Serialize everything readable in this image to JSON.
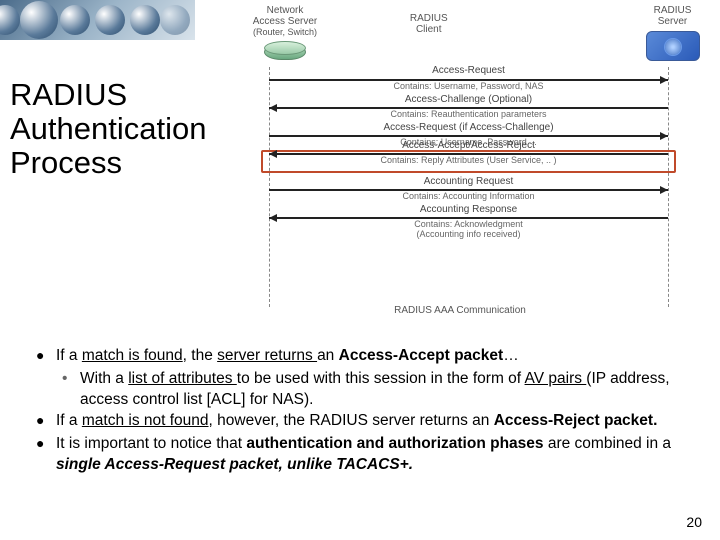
{
  "title": "RADIUS Authentication Process",
  "diagram": {
    "left": {
      "line1": "Network",
      "line2": "Access Server",
      "line3": "(Router, Switch)",
      "sub": "RADIUS\nClient"
    },
    "right": {
      "line1": "RADIUS",
      "line2": "Server"
    },
    "messages": [
      {
        "dir": "right",
        "label": "Access-Request",
        "sub": "Contains: Username, Password, NAS"
      },
      {
        "dir": "left",
        "label": "Access-Challenge (Optional)",
        "sub": "Contains: Reauthentication parameters"
      },
      {
        "dir": "right",
        "label": "Access-Request (if Access-Challenge)",
        "sub": "Contains: Username, Password, .."
      },
      {
        "dir": "left",
        "label": "Access-Accept/Access-Reject",
        "sub": "Contains: Reply Attributes (User Service, .. )",
        "hl": true
      },
      {
        "dir": "right",
        "label": "Accounting Request",
        "sub": "Contains: Accounting Information"
      },
      {
        "dir": "left",
        "label": "Accounting Response",
        "sub": "Contains: Acknowledgment\n(Accounting info received)"
      }
    ],
    "caption": "RADIUS AAA Communication"
  },
  "bullets": {
    "b1_pre": "If a ",
    "b1_u1": "match is found",
    "b1_mid": ", the ",
    "b1_u2": "server returns ",
    "b1_post1": "an ",
    "b1_bold": "Access-Accept packet",
    "b1_end": "…",
    "b1a_pre": "With a ",
    "b1a_u1": "list of attributes ",
    "b1a_mid": "to be used with this session in the form of ",
    "b1a_u2": "AV pairs ",
    "b1a_post": "(IP address, access control list [ACL] for NAS).",
    "b2_pre": "If a ",
    "b2_u": "match is not found",
    "b2_mid": ", however, the RADIUS server returns an ",
    "b2_bold": "Access-Reject packet.",
    "b3_pre": "It is important to notice that ",
    "b3_b1": "authentication and authorization phases",
    "b3_mid": " are combined in a ",
    "b3_bi": "single Access-Request packet, unlike TACACS+."
  },
  "page": "20"
}
